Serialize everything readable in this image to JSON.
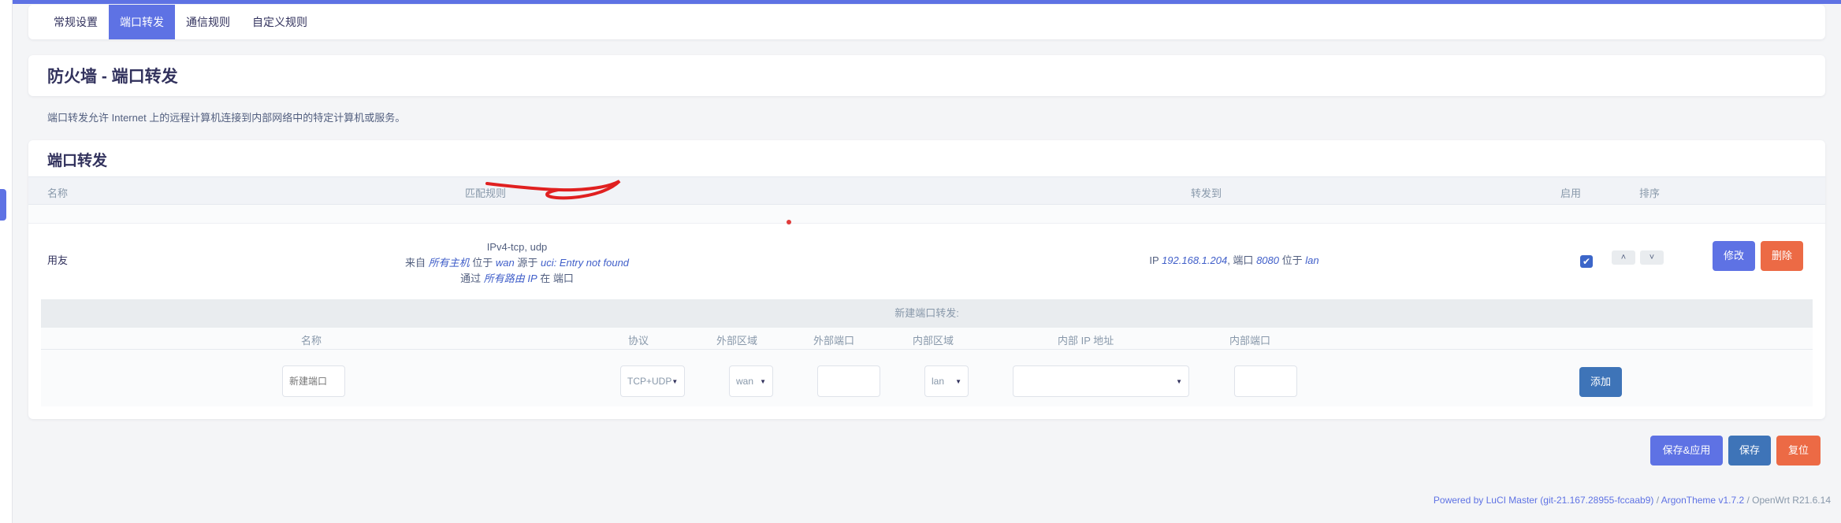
{
  "tabs": [
    {
      "label": "常规设置"
    },
    {
      "label": "端口转发"
    },
    {
      "label": "通信规则"
    },
    {
      "label": "自定义规则"
    }
  ],
  "page": {
    "title": "防火墙 - 端口转发",
    "description": "端口转发允许 Internet 上的远程计算机连接到内部网络中的特定计算机或服务。"
  },
  "section": {
    "title": "端口转发",
    "columns": {
      "name": "名称",
      "match": "匹配规则",
      "forward": "转发到",
      "enable": "启用",
      "sort": "排序"
    }
  },
  "rule": {
    "name": "用友",
    "proto": "IPv4-tcp, udp",
    "from_prefix": "来自",
    "from_host": "所有主机",
    "in_word": "位于",
    "src_zone": "wan",
    "src_word": "源于",
    "src_entry": "uci: Entry not found",
    "via_prefix": "通过",
    "via_router": "所有路由 IP",
    "at_port_word": "在 端口",
    "fwd_ip_label": "IP",
    "fwd_ip": "192.168.1.204",
    "fwd_port_label": ", 端口",
    "fwd_port": "8080",
    "fwd_in_word": "位于",
    "fwd_zone": "lan",
    "enabled_glyph": "✔",
    "up_glyph": "˄",
    "down_glyph": "˅",
    "edit_label": "修改",
    "delete_label": "删除"
  },
  "new_forward": {
    "title": "新建端口转发:",
    "columns": {
      "name": "名称",
      "protocol": "协议",
      "ext_zone": "外部区域",
      "ext_port": "外部端口",
      "int_zone": "内部区域",
      "int_ip": "内部 IP 地址",
      "int_port": "内部端口"
    },
    "name_placeholder": "新建端口",
    "protocol_value": "TCP+UDP",
    "ext_zone_value": "wan",
    "int_zone_value": "lan",
    "int_ip_value": "",
    "add_label": "添加"
  },
  "actions": {
    "save_apply": "保存&应用",
    "save": "保存",
    "reset": "复位"
  },
  "footer": {
    "powered": "Powered by LuCI Master (git-21.167.28955-fccaab9)",
    "sep1": " / ",
    "theme": "ArgonTheme v1.7.2",
    "sep2": " / ",
    "openwrt": "OpenWrt R21.6.14"
  },
  "colors": {
    "accent": "#5e72e4",
    "danger": "#ec6a45",
    "info": "#3e74b8"
  }
}
